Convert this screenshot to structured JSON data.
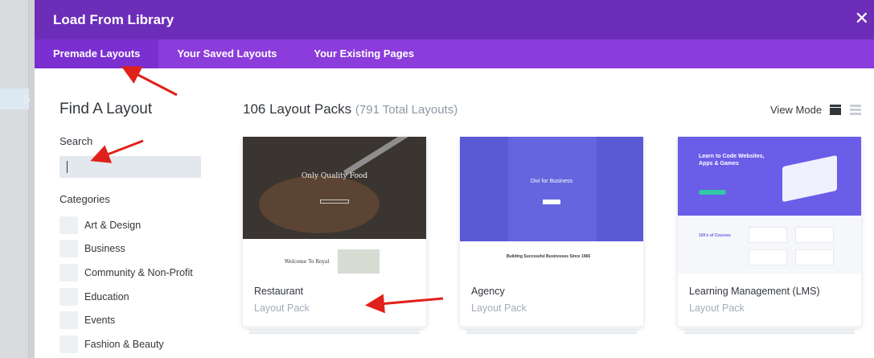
{
  "modal": {
    "title": "Load From Library",
    "close_icon": "close-icon"
  },
  "tabs": [
    {
      "label": "Premade Layouts",
      "active": true
    },
    {
      "label": "Your Saved Layouts",
      "active": false
    },
    {
      "label": "Your Existing Pages",
      "active": false
    }
  ],
  "sidebar": {
    "heading": "Find A Layout",
    "search_label": "Search",
    "search_value": "",
    "categories_label": "Categories",
    "categories": [
      "Art & Design",
      "Business",
      "Community & Non-Profit",
      "Education",
      "Events",
      "Fashion & Beauty"
    ]
  },
  "main": {
    "count_label": "106 Layout Packs",
    "total_label": "(791 Total Layouts)",
    "view_mode_label": "View Mode",
    "view_mode_icons": [
      "grid-view-icon",
      "list-view-icon"
    ],
    "cards": [
      {
        "name": "Restaurant",
        "type": "Layout Pack",
        "thumb_text": "Only Quality Food",
        "thumb_sub": "Welcome To Royal"
      },
      {
        "name": "Agency",
        "type": "Layout Pack",
        "thumb_text": "Divi for Business",
        "thumb_sub": "Building Successful Businesses Since 1965"
      },
      {
        "name": "Learning Management (LMS)",
        "type": "Layout Pack",
        "thumb_text": "Learn to Code Websites, Apps & Games",
        "thumb_sub": "100's of Courses"
      }
    ]
  },
  "colors": {
    "header": "#6c2eb9",
    "tabs": "#8b3cdb",
    "annotation_arrow": "#e0201b"
  }
}
